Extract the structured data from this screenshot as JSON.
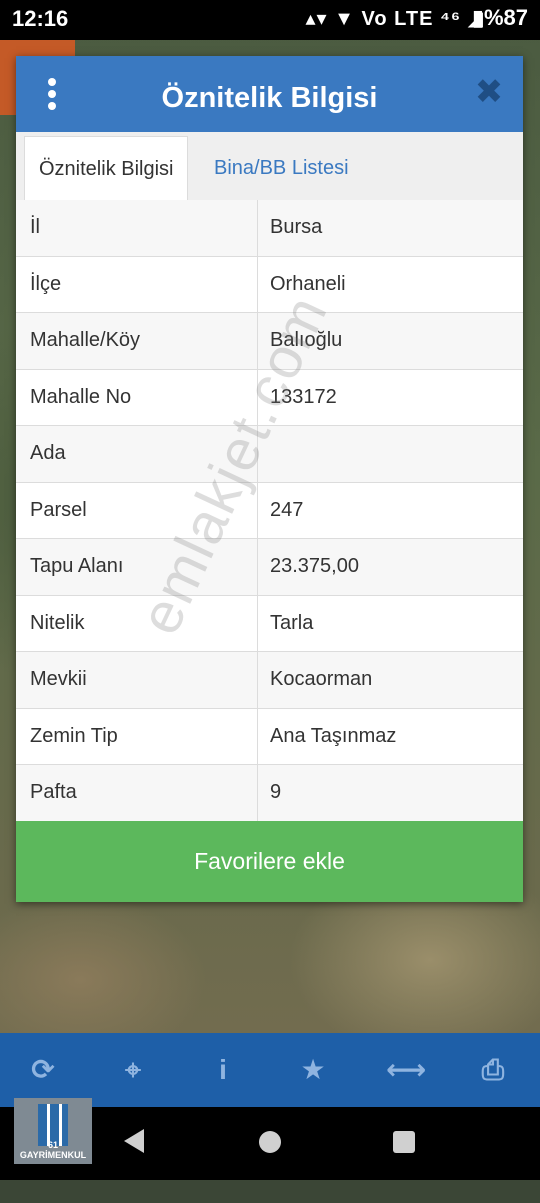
{
  "status_bar": {
    "time": "12:16",
    "indicators": "▴▾ ▼ Vo LTE ⁴⁶ ◢",
    "battery": "▮%87"
  },
  "dialog": {
    "title": "Öznitelik Bilgisi",
    "close_label": "✖",
    "tabs": [
      {
        "label": "Öznitelik Bilgisi",
        "active": true
      },
      {
        "label": "Bina/BB Listesi",
        "active": false
      }
    ],
    "rows": [
      {
        "key": "İl",
        "value": "Bursa"
      },
      {
        "key": "İlçe",
        "value": "Orhaneli"
      },
      {
        "key": "Mahalle/Köy",
        "value": "Balıoğlu"
      },
      {
        "key": "Mahalle No",
        "value": "133172"
      },
      {
        "key": "Ada",
        "value": ""
      },
      {
        "key": "Parsel",
        "value": "247"
      },
      {
        "key": "Tapu Alanı",
        "value": "23.375,00"
      },
      {
        "key": "Nitelik",
        "value": "Tarla"
      },
      {
        "key": "Mevkii",
        "value": "Kocaorman"
      },
      {
        "key": "Zemin Tip",
        "value": "Ana Taşınmaz"
      },
      {
        "key": "Pafta",
        "value": "9"
      }
    ],
    "favorite_button": "Favorilere ekle"
  },
  "watermark": "emlakjet.com",
  "toolbar": {
    "icons": [
      "refresh-icon",
      "locate-icon",
      "info-icon",
      "star-icon",
      "measure-icon",
      "print-icon"
    ],
    "glyphs": [
      "⟳",
      "⌖",
      "i",
      "★",
      "⟷",
      "⎙"
    ]
  },
  "logo": {
    "text": "61 GAYRİMENKUL"
  },
  "colors": {
    "header": "#3a79c1",
    "favorite": "#5cb85c",
    "toolbar": "#1e5fa8",
    "tab_link": "#3a79c1"
  }
}
